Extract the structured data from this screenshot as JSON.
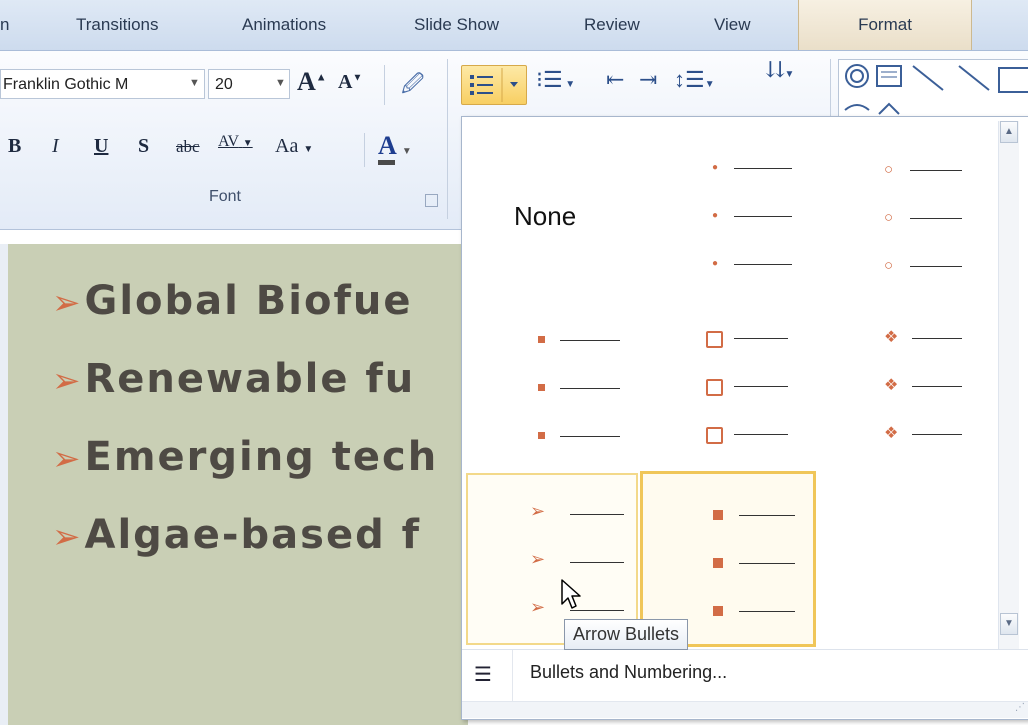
{
  "tabs": {
    "partial_left": "n",
    "transitions": "Transitions",
    "animations": "Animations",
    "slide_show": "Slide Show",
    "review": "Review",
    "view": "View",
    "format": "Format"
  },
  "ribbon": {
    "font_name": "Franklin Gothic M",
    "font_size": "20",
    "grow_font": "A",
    "shrink_font": "A",
    "bold": "B",
    "italic": "I",
    "underline": "U",
    "shadow": "S",
    "strikethrough": "abc",
    "char_spacing": "AV",
    "change_case": "Aa",
    "font_color": "A",
    "font_group_label": "Font"
  },
  "slide": {
    "bullets": [
      "Global Biofue",
      "Renewable fu",
      "Emerging tech",
      "Algae-based f"
    ]
  },
  "gallery": {
    "none_label": "None",
    "footer_label": "Bullets and Numbering...",
    "tooltip": "Arrow Bullets",
    "colors": {
      "bullet": "#d26c46",
      "highlight": "#f0c659"
    }
  }
}
